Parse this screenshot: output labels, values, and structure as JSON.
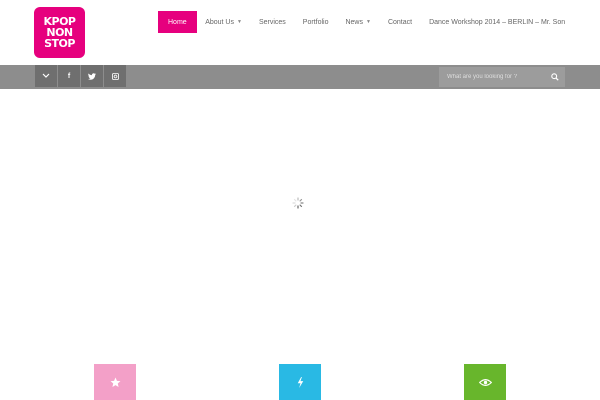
{
  "logo": {
    "lines": [
      "KPOP",
      "NON",
      "STOP"
    ]
  },
  "nav": {
    "items": [
      {
        "label": "Home",
        "active": true,
        "dropdown": false
      },
      {
        "label": "About Us",
        "active": false,
        "dropdown": true
      },
      {
        "label": "Services",
        "active": false,
        "dropdown": false
      },
      {
        "label": "Portfolio",
        "active": false,
        "dropdown": false
      },
      {
        "label": "News",
        "active": false,
        "dropdown": true
      },
      {
        "label": "Contact",
        "active": false,
        "dropdown": false
      },
      {
        "label": "Dance Workshop 2014 – BERLIN – Mr. Son",
        "active": false,
        "dropdown": false
      }
    ]
  },
  "social": {
    "icons": [
      "chevron-down-icon",
      "facebook-icon",
      "twitter-icon",
      "instagram-icon"
    ],
    "glyphs": [
      "⌄",
      "f",
      "t",
      "◘"
    ]
  },
  "search": {
    "placeholder": "What are you looking for ?"
  },
  "features": [
    {
      "icon": "star-icon",
      "color": "#f3a0c8"
    },
    {
      "icon": "lightning-icon",
      "color": "#29b9e4"
    },
    {
      "icon": "eye-icon",
      "color": "#68b62c"
    }
  ],
  "colors": {
    "brand": "#e6007e",
    "bar": "#8d8d8d",
    "bar_button": "#6f6f6f"
  }
}
